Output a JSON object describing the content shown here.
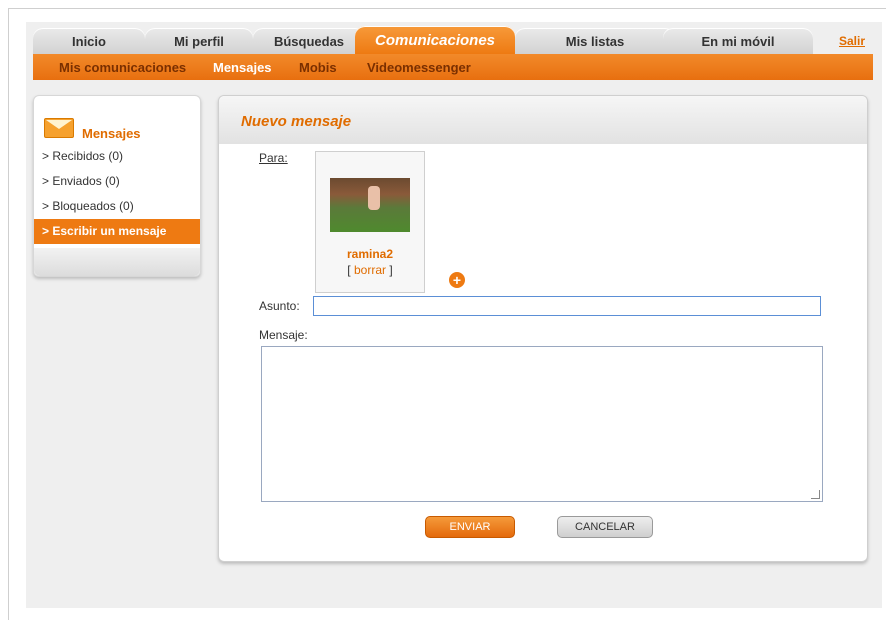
{
  "tabs": {
    "items": [
      "Inicio",
      "Mi perfil",
      "Búsquedas",
      "Comunicaciones",
      "Mis listas",
      "En mi móvil"
    ],
    "active": "Comunicaciones",
    "logout": "Salir"
  },
  "subnav": {
    "items": [
      "Mis comunicaciones",
      "Mensajes",
      "Mobis",
      "Videomessenger"
    ],
    "active": "Mensajes"
  },
  "sidebar": {
    "title": "Mensajes",
    "items": [
      {
        "label": "> Recibidos (0)"
      },
      {
        "label": "> Enviados (0)"
      },
      {
        "label": "> Bloqueados (0)"
      },
      {
        "label": "> Escribir un mensaje"
      }
    ]
  },
  "compose": {
    "title": "Nuevo mensaje",
    "to_label": "Para:",
    "recipient_name": "ramina2",
    "remove_open": "[",
    "remove_label": "borrar",
    "remove_close": "]",
    "subject_label": "Asunto:",
    "subject_value": "",
    "message_label": "Mensaje:",
    "message_value": "",
    "send_label": "ENVIAR",
    "cancel_label": "CANCELAR"
  },
  "colors": {
    "accent": "#ee7a12",
    "accent_text": "#e06c00"
  }
}
